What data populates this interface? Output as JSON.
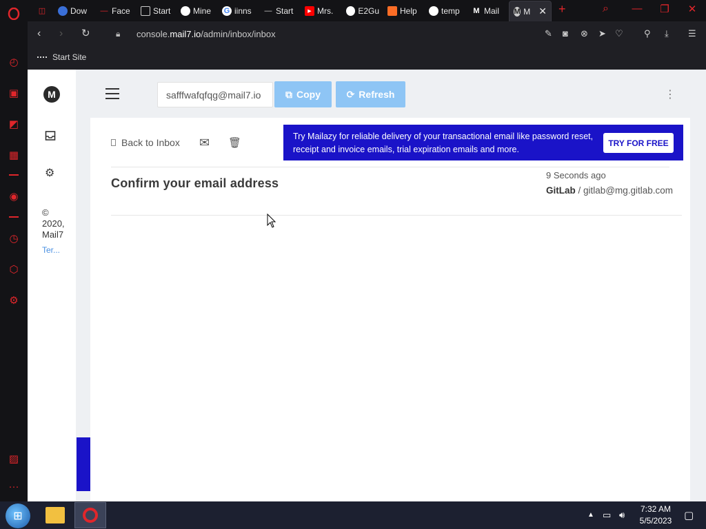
{
  "browser": {
    "tabs": [
      {
        "label": "",
        "icon": "gamepad-icon",
        "icon_color": "#e0262b"
      },
      {
        "label": "Dow",
        "icon": "chrome-icon",
        "icon_color": "#3a6fd8"
      },
      {
        "label": "Face",
        "icon": "dash-icon",
        "icon_color": "#e0262b"
      },
      {
        "label": "Start",
        "icon": "page-icon",
        "icon_color": "#d0d0d0"
      },
      {
        "label": "Mine",
        "icon": "globe-icon",
        "icon_color": "#ffffff"
      },
      {
        "label": "iinns",
        "icon": "google-icon",
        "icon_color": "#4285f4"
      },
      {
        "label": "Start",
        "icon": "dash-icon",
        "icon_color": "#d0d0d0"
      },
      {
        "label": "Mrs.",
        "icon": "youtube-icon",
        "icon_color": "#ff0000"
      },
      {
        "label": "E2Gu",
        "icon": "github-icon",
        "icon_color": "#ffffff"
      },
      {
        "label": "Help",
        "icon": "gitlab-icon",
        "icon_color": "#fc6d26"
      },
      {
        "label": "temp",
        "icon": "globe-icon",
        "icon_color": "#ffffff"
      },
      {
        "label": "Mail",
        "icon": "mail7-icon",
        "icon_color": "#ffffff"
      },
      {
        "label": "M",
        "icon": "mail7-icon",
        "icon_color": "#ffffff",
        "active": true
      }
    ],
    "url_prefix": "console.",
    "url_domain": "mail7.io",
    "url_path": "/admin/inbox/inbox",
    "bookmark": "Start Site"
  },
  "app": {
    "logo_letter": "M",
    "copyright": "© 2020, Mail7",
    "copyright_lines": [
      "©",
      "2020,",
      "Mail7"
    ],
    "terms": "Ter...",
    "email_value": "safffwafqfqg@mail7.io",
    "copy_label": "Copy",
    "refresh_label": "Refresh",
    "back_label": "Back to Inbox",
    "promo_text": "Try Mailazy for reliable delivery of your transactional email like password reset, receipt and invoice emails, trial expiration emails and more.",
    "promo_button": "TRY FOR FREE",
    "subject": "Confirm your email address",
    "received": "9 Seconds ago",
    "sender_name": "GitLab",
    "sender_sep": "/",
    "sender_email": "gitlab@mg.gitlab.com"
  },
  "taskbar": {
    "time": "7:32 AM",
    "date": "5/5/2023"
  },
  "colors": {
    "opera_red": "#e0262b",
    "button_blue": "#8ec5f5",
    "promo_blue": "#1a13c8"
  }
}
